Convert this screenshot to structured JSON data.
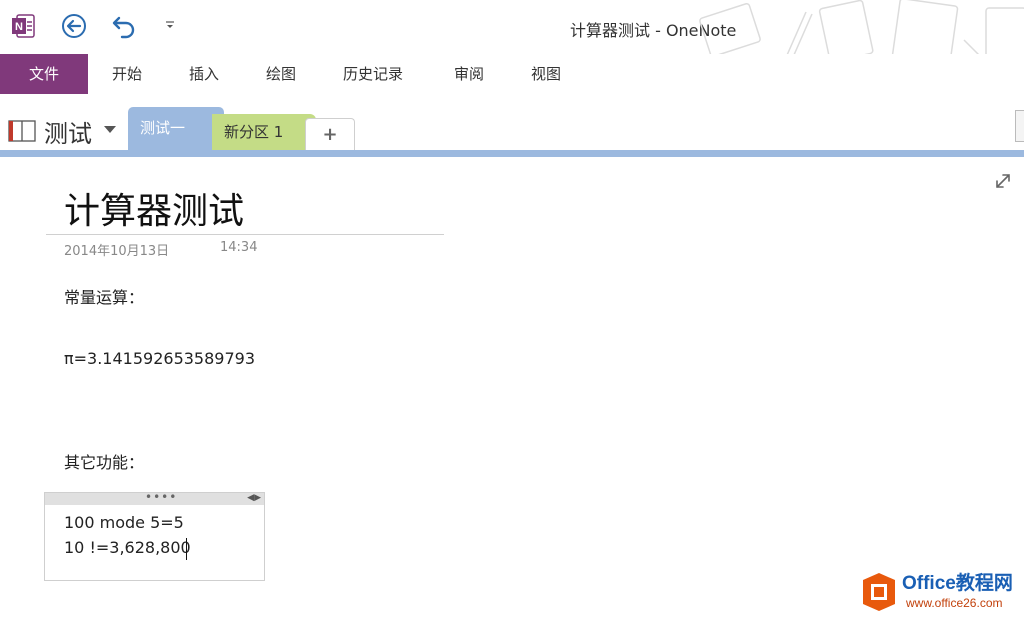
{
  "app": {
    "title": "计算器测试 - OneNote",
    "logo": "onenote-logo-icon",
    "colors": {
      "file_tab": "#80397b",
      "section1": "#9cb9df",
      "section2": "#c4dc86"
    }
  },
  "ribbon": {
    "tabs": [
      "文件",
      "开始",
      "插入",
      "绘图",
      "历史记录",
      "审阅",
      "视图"
    ]
  },
  "notebook": {
    "name": "测试",
    "sections": [
      "测试一",
      "新分区 1"
    ],
    "add_section_label": "+"
  },
  "page": {
    "title": "计算器测试",
    "date": "2014年10月13日",
    "time": "14:34",
    "paragraphs": [
      "常量运算：",
      "π=3.141592653589793",
      "其它功能："
    ],
    "note_lines": [
      "100 mode 5=5",
      "10 !=3,628,800"
    ]
  }
}
